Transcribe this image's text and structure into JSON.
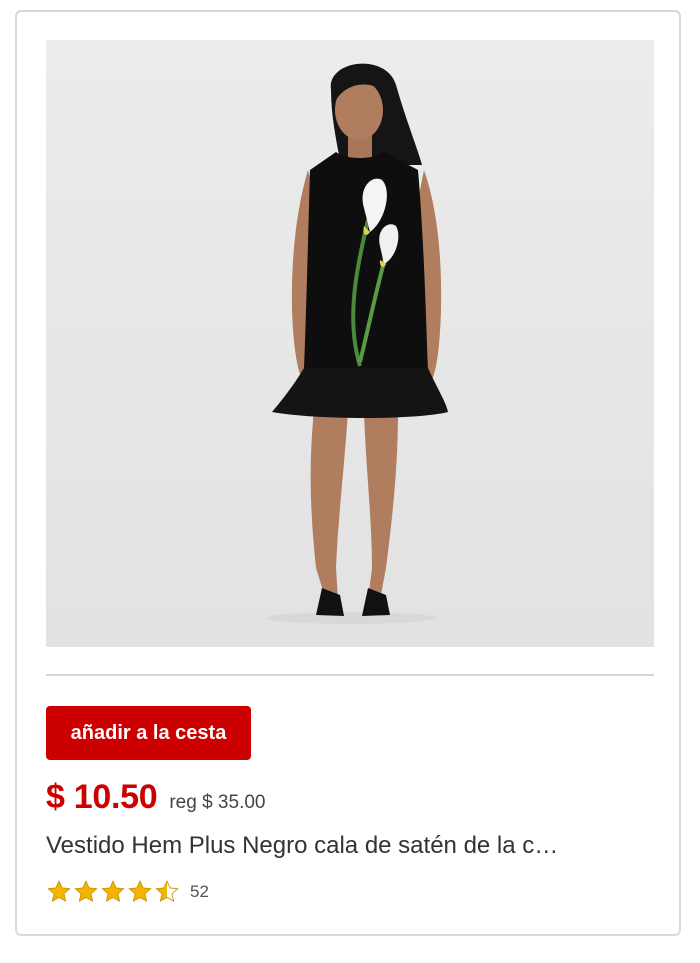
{
  "product": {
    "image_alt": "Vestido negro con estampado de calas",
    "add_to_cart_label": "añadir a la cesta",
    "sale_price": "$ 10.50",
    "regular_price": "reg $ 35.00",
    "title": "Vestido Hem Plus Negro cala de satén de la c…",
    "rating": 4.5,
    "rating_max": 5,
    "review_count": "52"
  },
  "colors": {
    "accent": "#cc0000",
    "star": "#f5b400",
    "divider": "#d6d6d6"
  }
}
